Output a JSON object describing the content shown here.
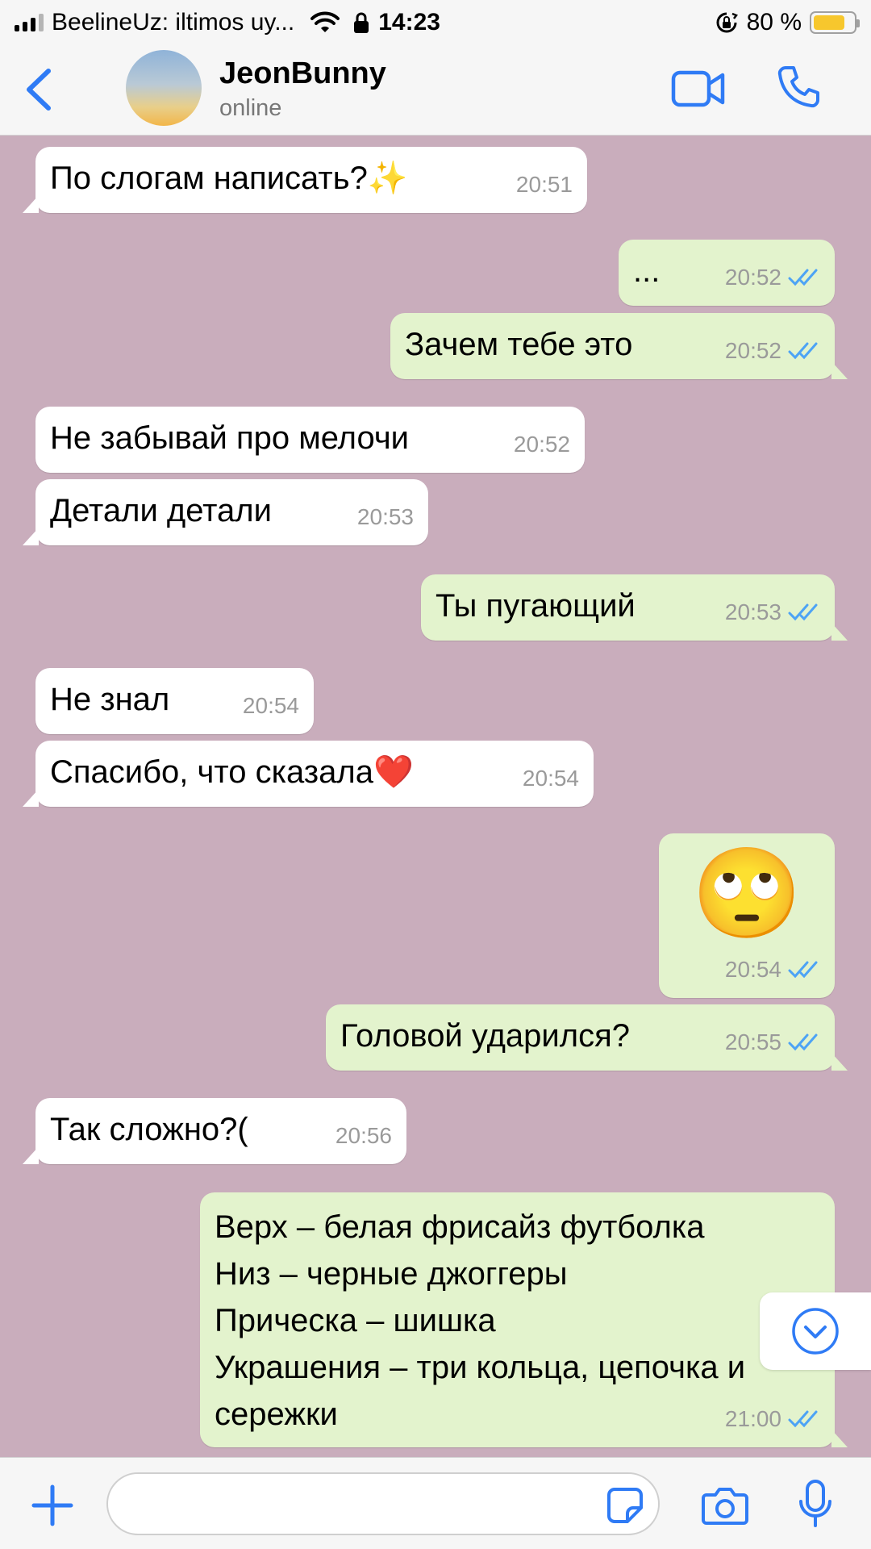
{
  "status_bar": {
    "carrier": "BeelineUz: iltimos uy...",
    "time": "14:23",
    "battery": "80 %",
    "battery_level": 0.8
  },
  "header": {
    "contact_name": "JeonBunny",
    "contact_status": "online"
  },
  "messages": [
    {
      "text": "По слогам написать?✨",
      "time": "20:51"
    },
    {
      "text": "...",
      "time": "20:52"
    },
    {
      "text": "Зачем тебе это",
      "time": "20:52"
    },
    {
      "text": "Не забывай про мелочи",
      "time": "20:52"
    },
    {
      "text": "Детали детали",
      "time": "20:53"
    },
    {
      "text": "Ты пугающий",
      "time": "20:53"
    },
    {
      "text": "Не знал",
      "time": "20:54"
    },
    {
      "text": "Спасибо, что сказала❤️",
      "time": "20:54"
    },
    {
      "text": "🙄",
      "time": "20:54"
    },
    {
      "text": "Головой ударился?",
      "time": "20:55"
    },
    {
      "text": "Так сложно?(",
      "time": "20:56"
    },
    {
      "text": "Верх – белая фрисайз футболка\nНиз – черные джоггеры\nПрическа – шишка\nУкрашения – три кольца, цепочка и\nсережки",
      "time": "21:00"
    }
  ],
  "input": {
    "placeholder": ""
  },
  "colors": {
    "chat_background": "#c9adbc",
    "incoming_bubble": "#ffffff",
    "outgoing_bubble": "#e3f3cd",
    "accent": "#2f7bf5",
    "read_ticks": "#4da3f5"
  }
}
